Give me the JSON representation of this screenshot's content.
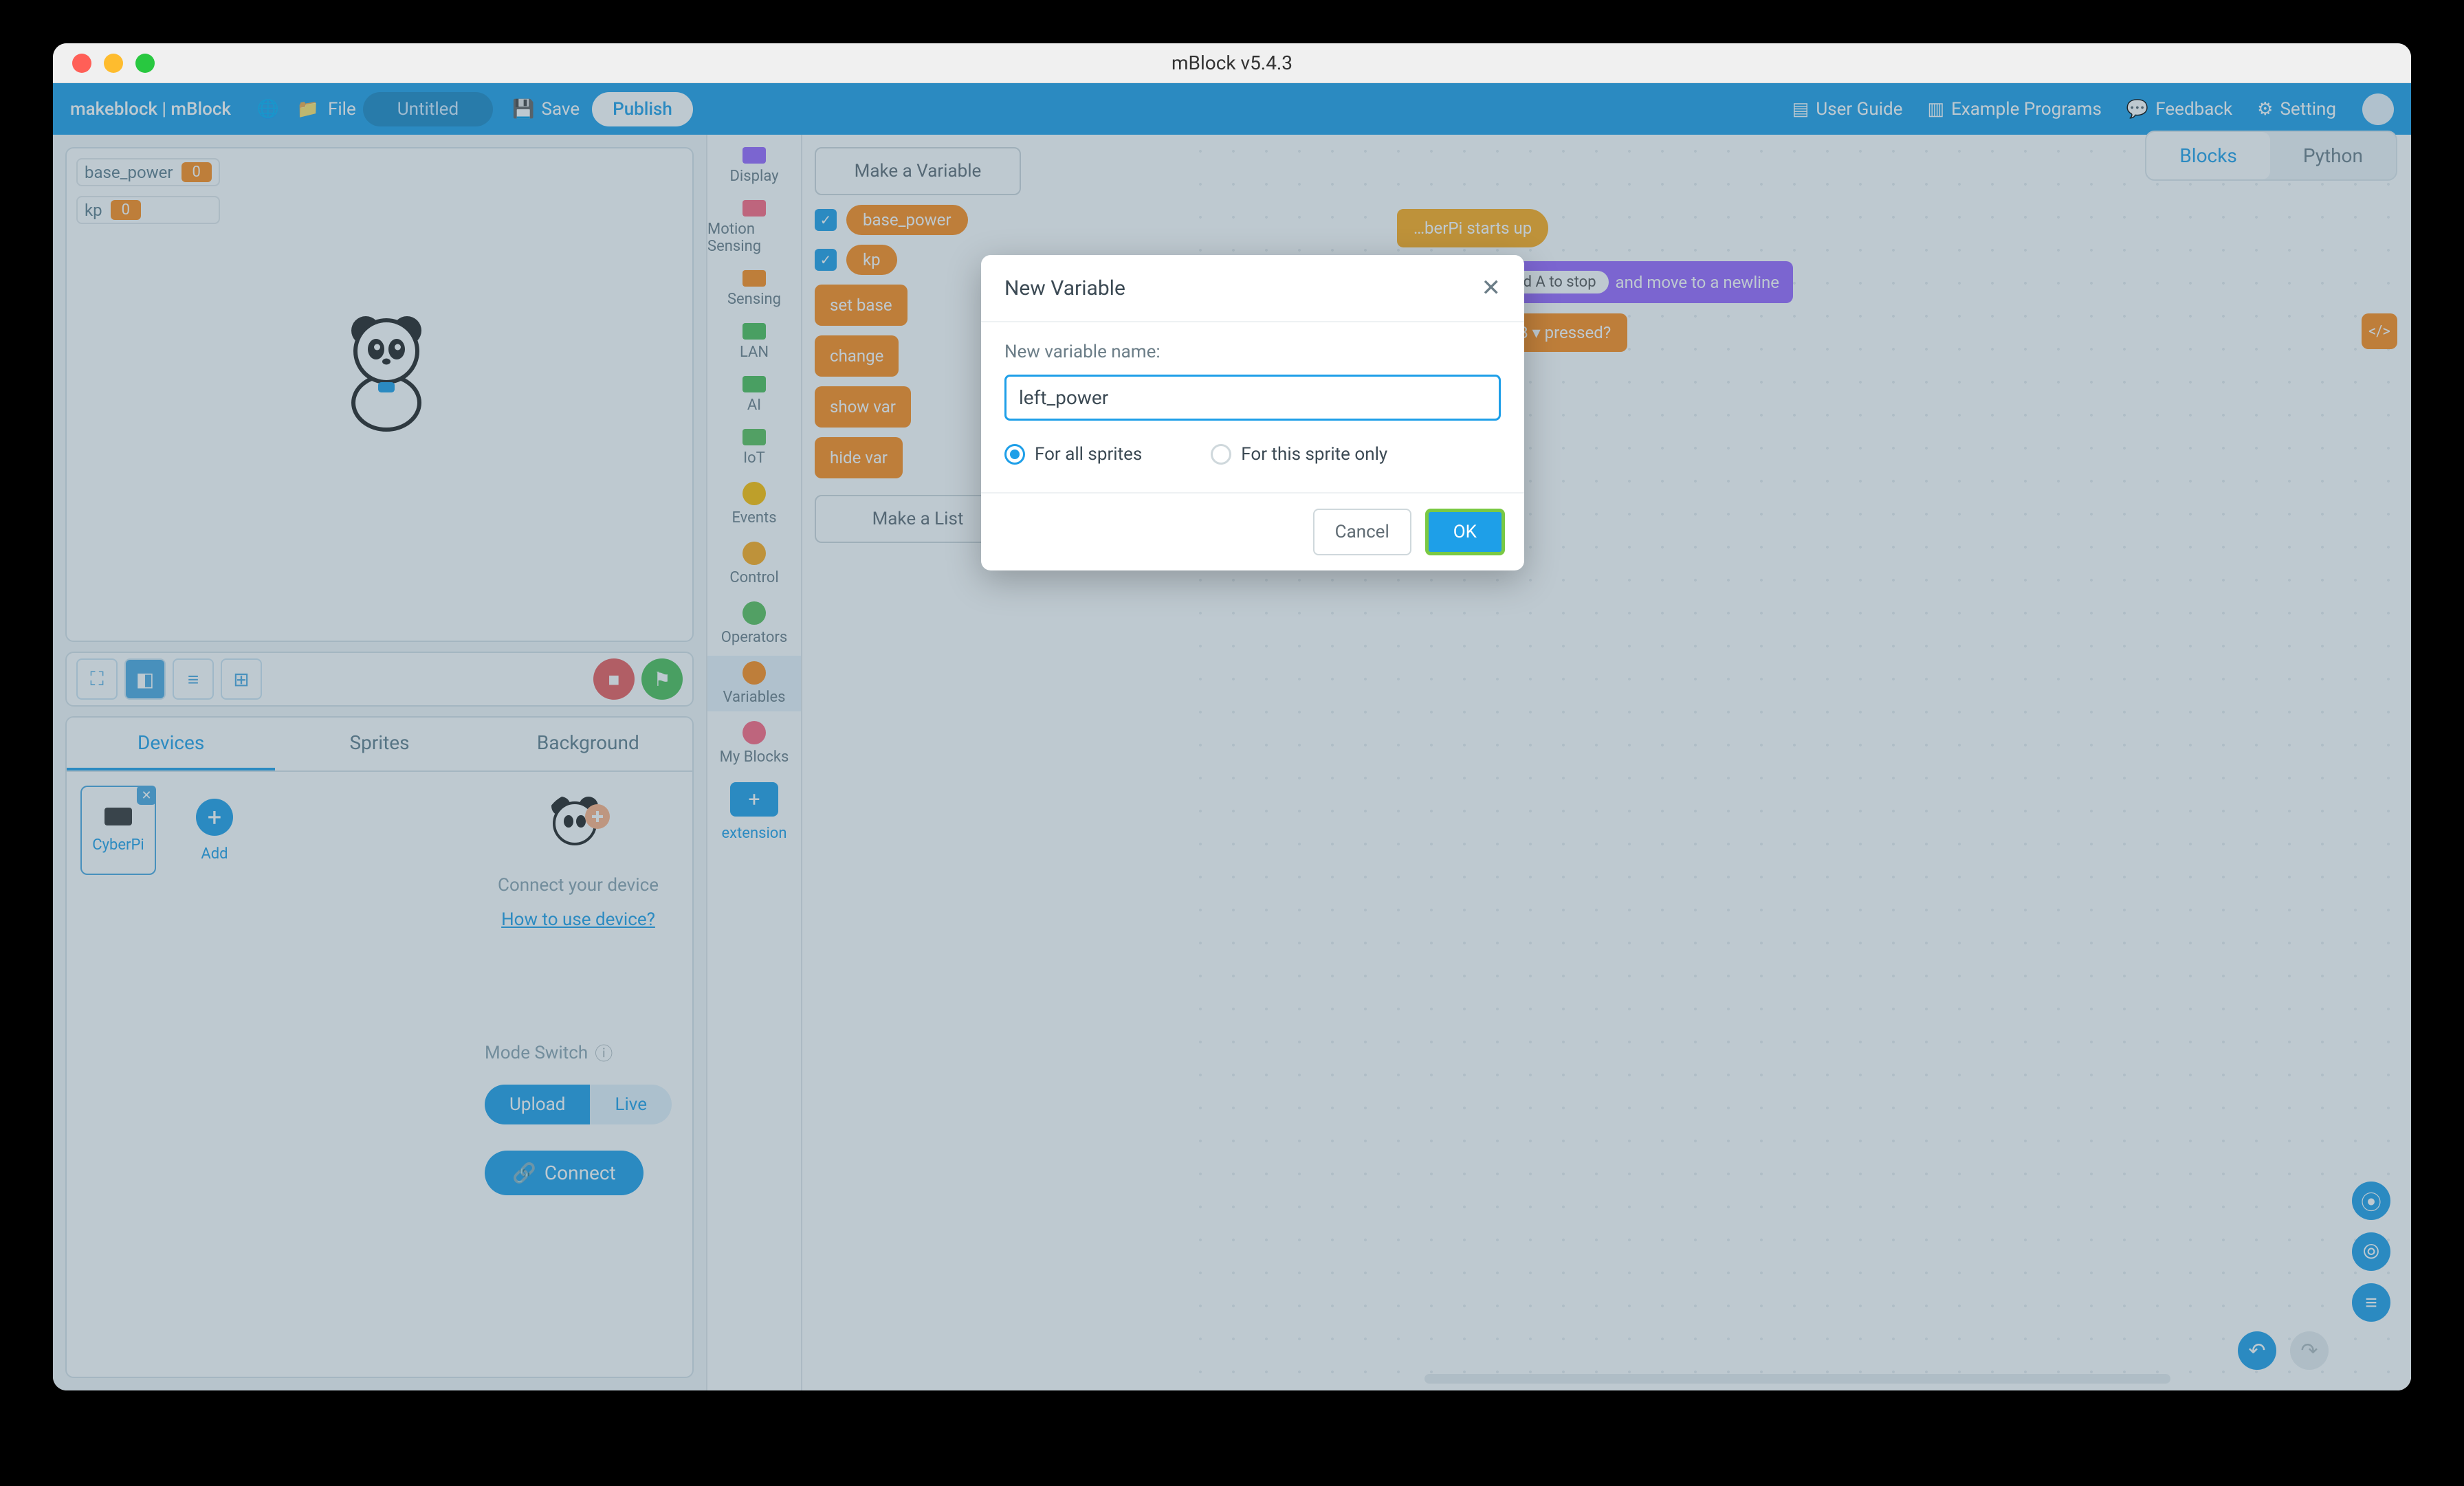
{
  "window": {
    "title": "mBlock v5.4.3"
  },
  "topbar": {
    "brand": "makeblock | mBlock",
    "file_label": "File",
    "project_name": "Untitled",
    "save_label": "Save",
    "publish_label": "Publish",
    "user_guide": "User Guide",
    "example_programs": "Example Programs",
    "feedback": "Feedback",
    "setting": "Setting"
  },
  "stage": {
    "monitors": [
      {
        "name": "base_power",
        "value": "0"
      },
      {
        "name": "kp",
        "value": "0"
      }
    ]
  },
  "asset_tabs": {
    "devices": "Devices",
    "sprites": "Sprites",
    "background": "Background"
  },
  "devices": {
    "card_name": "CyberPi",
    "add_label": "Add",
    "connect_prompt": "Connect your device",
    "how_to": "How to use device?",
    "mode_switch": "Mode Switch",
    "upload": "Upload",
    "live": "Live",
    "connect": "Connect"
  },
  "categories": [
    {
      "name": "Display",
      "color": "#9966ff",
      "shape": "square"
    },
    {
      "name": "Motion Sensing",
      "color": "#ff6680",
      "shape": "square"
    },
    {
      "name": "Sensing",
      "color": "#ff8c1a",
      "shape": "square"
    },
    {
      "name": "LAN",
      "color": "#4cbf56",
      "shape": "square"
    },
    {
      "name": "AI",
      "color": "#4cbf56",
      "shape": "square"
    },
    {
      "name": "IoT",
      "color": "#59c059",
      "shape": "square"
    },
    {
      "name": "Events",
      "color": "#ffbf00"
    },
    {
      "name": "Control",
      "color": "#ffab19"
    },
    {
      "name": "Operators",
      "color": "#59c059"
    },
    {
      "name": "Variables",
      "color": "#ff8c1a",
      "selected": true
    },
    {
      "name": "My Blocks",
      "color": "#ff6680"
    }
  ],
  "extension_label": "extension",
  "palette": {
    "make_variable": "Make a Variable",
    "vars": [
      "base_power",
      "kp"
    ],
    "blocks": [
      "set   base",
      "change",
      "show var",
      "hide var"
    ],
    "make_list": "Make a List"
  },
  "script_tabs": {
    "blocks": "Blocks",
    "python": "Python"
  },
  "scripts": {
    "hat": "…berPi starts up",
    "purple": {
      "prefix": "",
      "oval": "Press B to start line following and A to stop",
      "suffix": "and move to a newline"
    },
    "orange": {
      "text": "button   B ▾    pressed?",
      "icon": "□"
    }
  },
  "modal": {
    "title": "New Variable",
    "label": "New variable name:",
    "input_value": "left_power",
    "radio_all": "For all sprites",
    "radio_this": "For this sprite only",
    "cancel": "Cancel",
    "ok": "OK"
  }
}
